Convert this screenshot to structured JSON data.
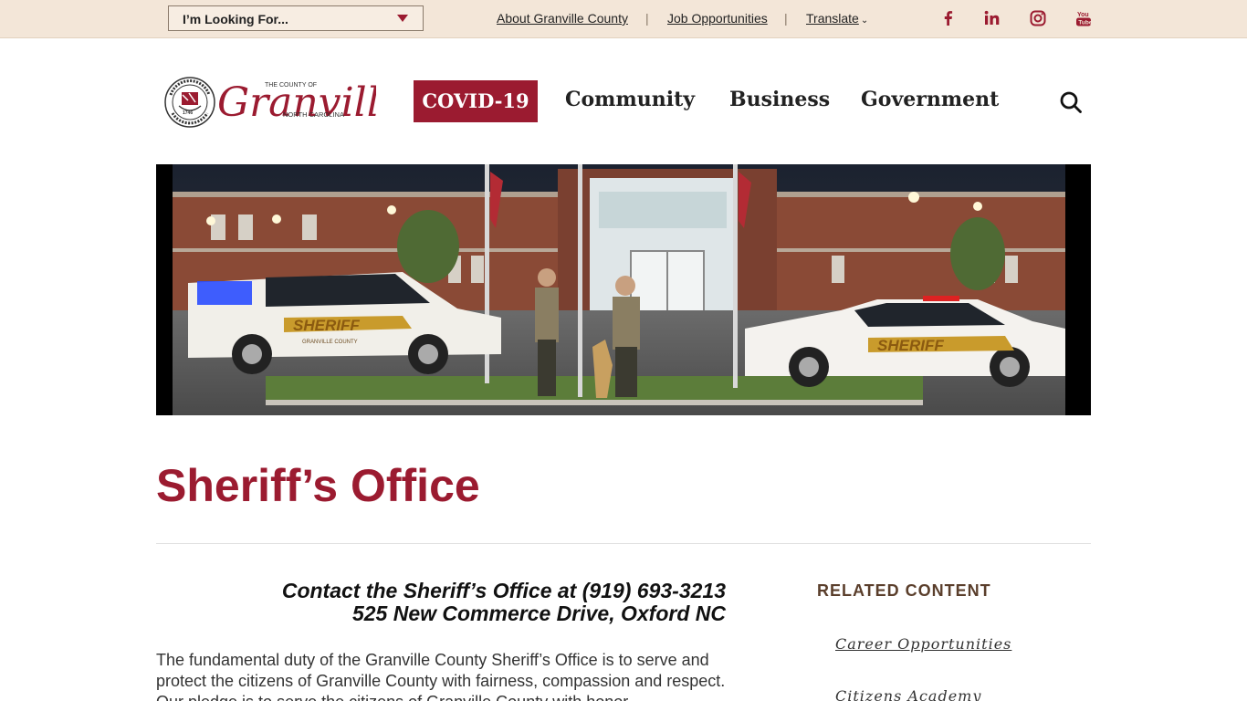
{
  "topbar": {
    "looking_for": "I’m Looking For...",
    "links": {
      "about": "About Granville County",
      "jobs": "Job Opportunities",
      "translate": "Translate"
    },
    "separator": "|",
    "social_icons": [
      "facebook-icon",
      "linkedin-icon",
      "instagram-icon",
      "youtube-icon"
    ]
  },
  "logo": {
    "small_top": "THE COUNTY OF",
    "name": "Granville",
    "state": "NORTH CAROLINA",
    "seal_text": "THE COUNTY OF GRANVILLE • NORTH CAROLINA •",
    "seal_year": "1746"
  },
  "nav": {
    "covid": "COVID-19",
    "community": "Community",
    "business": "Business",
    "government": "Government"
  },
  "hero": {
    "vehicle_text": "SHERIFF",
    "vehicle_subtext": "GRANVILLE COUNTY"
  },
  "page": {
    "title": "Sheriff’s Office",
    "contact_line1": "Contact the Sheriff’s Office at (919) 693-3213",
    "contact_line2": "525 New Commerce Drive, Oxford NC",
    "body": "The fundamental duty of the Granville County Sheriff’s Office is to serve and protect the citizens of Granville County with fairness, compassion and respect. Our pledge is to serve the citizens of Granville County with honor"
  },
  "related": {
    "heading": "RELATED CONTENT",
    "links": [
      "Career Opportunities",
      "Citizens Academy"
    ]
  },
  "colors": {
    "brand": "#9b1b30",
    "topbar_bg": "#f3e6d8",
    "related_heading": "#5a3e2b"
  }
}
